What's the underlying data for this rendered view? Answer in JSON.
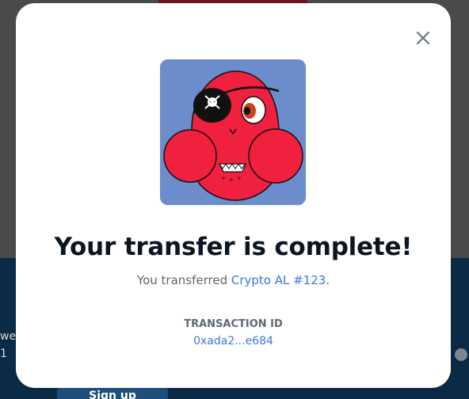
{
  "background": {
    "partial_text": "we",
    "partial_text_2": "1",
    "button_label": "Sign up"
  },
  "modal": {
    "close_icon": "close-icon",
    "image_alt": "Crypto AL #123 pirate NFT artwork",
    "title": "Your transfer is complete!",
    "subtitle_prefix": "You transferred ",
    "item_name": "Crypto AL #123",
    "subtitle_suffix": ".",
    "transaction_label": "TRANSACTION ID",
    "transaction_id": "0xada2...e684"
  },
  "colors": {
    "accent": "#3b78d4",
    "title": "#0d1424",
    "nft_background": "#6b8dcb",
    "nft_body": "#f0203f"
  }
}
